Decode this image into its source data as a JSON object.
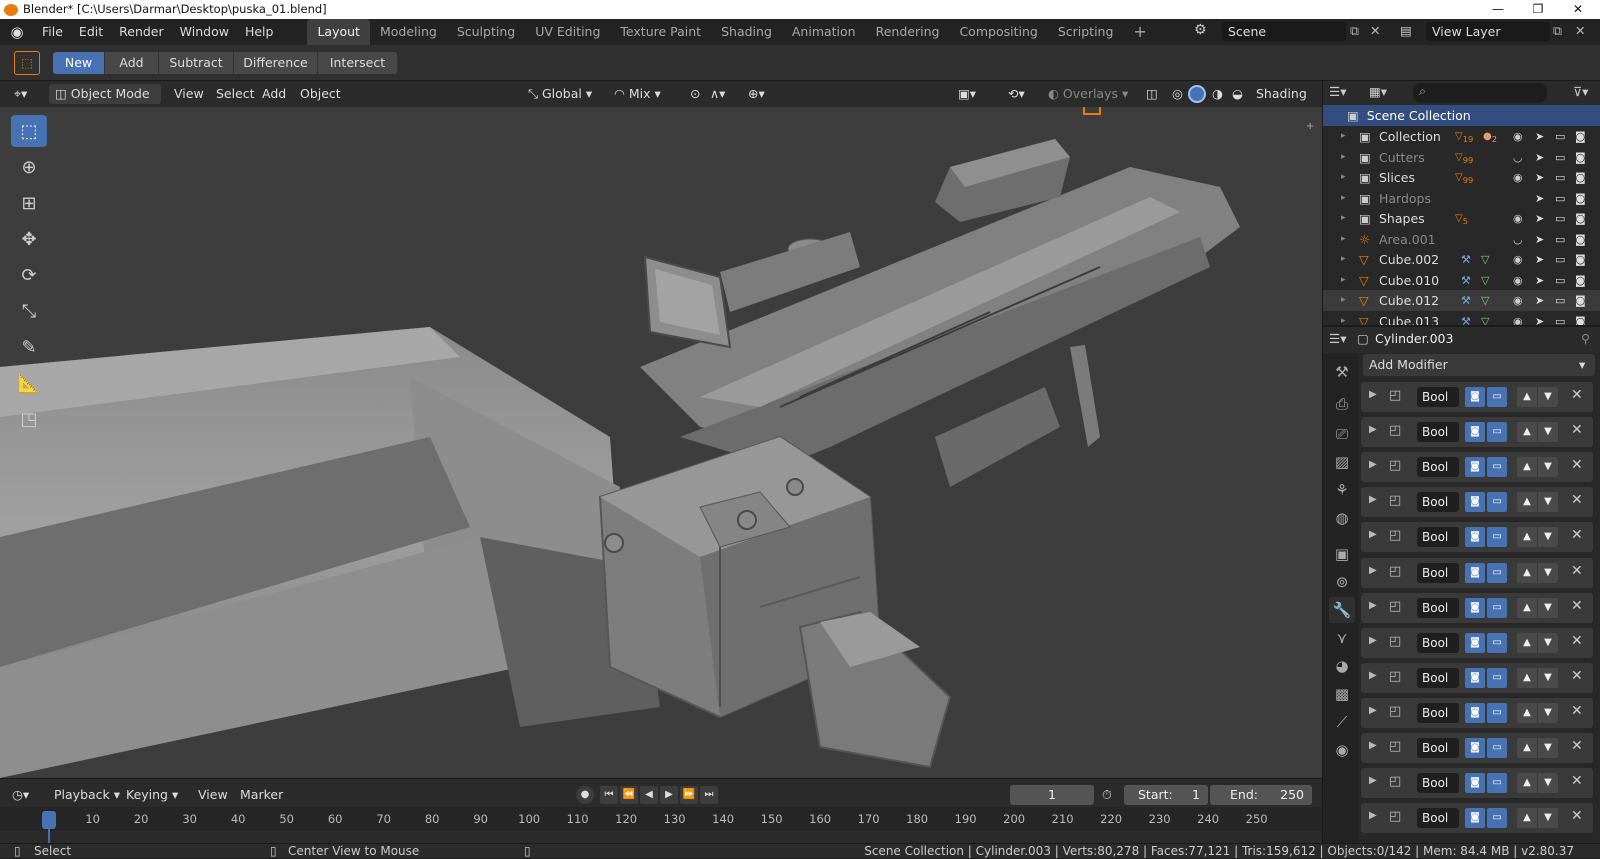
{
  "titlebar": {
    "title": "Blender* [C:\\Users\\Darmar\\Desktop\\puska_01.blend]",
    "min": "—",
    "max": "❐",
    "close": "✕"
  },
  "menu": [
    "File",
    "Edit",
    "Render",
    "Window",
    "Help"
  ],
  "workspaces": [
    "Layout",
    "Modeling",
    "Sculpting",
    "UV Editing",
    "Texture Paint",
    "Shading",
    "Animation",
    "Rendering",
    "Compositing",
    "Scripting"
  ],
  "scene": {
    "name": "Scene",
    "view_layer": "View Layer"
  },
  "boolean_tool": {
    "new": "New",
    "add": "Add",
    "subtract": "Subtract",
    "difference": "Difference",
    "intersect": "Intersect"
  },
  "viewport_header": {
    "mode": "Object Mode",
    "view": "View",
    "select": "Select",
    "add": "Add",
    "object": "Object",
    "orientation": "Global",
    "snap": "Mix",
    "overlays": "Overlays",
    "shading": "Shading"
  },
  "outliner": {
    "root": "Scene Collection",
    "rows": [
      {
        "name": "Collection",
        "badge1": "19",
        "badge2": "2"
      },
      {
        "name": "Cutters",
        "badge1": "99"
      },
      {
        "name": "Slices",
        "badge1": "99"
      },
      {
        "name": "Hardops"
      },
      {
        "name": "Shapes",
        "badge1": "5"
      },
      {
        "name": "Area.001"
      },
      {
        "name": "Cube.002"
      },
      {
        "name": "Cube.010"
      },
      {
        "name": "Cube.012"
      },
      {
        "name": "Cube.013"
      }
    ]
  },
  "properties": {
    "object": "Cylinder.003",
    "add_modifier": "Add Modifier",
    "modifier_name": "Bool",
    "modifier_count": 13
  },
  "timeline": {
    "playback": "Playback",
    "keying": "Keying",
    "view": "View",
    "marker": "Marker",
    "current": "1",
    "start_label": "Start:",
    "start": "1",
    "end_label": "End:",
    "end": "250",
    "ticks": [
      "1",
      "10",
      "20",
      "30",
      "40",
      "50",
      "60",
      "70",
      "80",
      "90",
      "100",
      "110",
      "120",
      "130",
      "140",
      "150",
      "160",
      "170",
      "180",
      "190",
      "200",
      "210",
      "220",
      "230",
      "240",
      "250"
    ]
  },
  "status": {
    "left": "Select",
    "middle": "Center View to Mouse",
    "right": "Scene Collection | Cylinder.003 | Verts:80,278 | Faces:77,121 | Tris:159,612 | Objects:0/142 | Mem: 84.4 MB | v2.80.37"
  },
  "colors": {
    "accent": "#4772b3",
    "orange": "#e87d0d",
    "viewport_bg": "#3d3d3d"
  }
}
